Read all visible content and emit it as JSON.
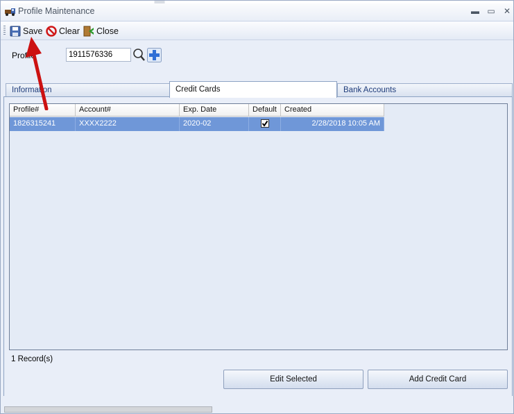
{
  "window": {
    "title": "Profile Maintenance",
    "minimize_glyph": "▬",
    "restore_glyph": "▭",
    "close_glyph": "✕"
  },
  "toolbar": {
    "save_label": "Save",
    "clear_label": "Clear",
    "close_label": "Close"
  },
  "profile": {
    "label": "Profile",
    "value": "1911576336"
  },
  "tabs": [
    {
      "label": "Information"
    },
    {
      "label": "Credit Cards"
    },
    {
      "label": "Bank Accounts"
    }
  ],
  "grid": {
    "columns": [
      "Profile#",
      "Account#",
      "Exp. Date",
      "Default",
      "Created"
    ],
    "rows": [
      {
        "profile": "1826315241",
        "account": "XXXX2222",
        "exp": "2020-02",
        "default": true,
        "created": "2/28/2018 10:05 AM"
      }
    ]
  },
  "records_text": "1 Record(s)",
  "buttons": {
    "edit_selected": "Edit Selected",
    "add_credit_card": "Add Credit Card"
  },
  "colors": {
    "selected_row": "#6f97d8",
    "annotation_arrow": "#cc1111"
  }
}
